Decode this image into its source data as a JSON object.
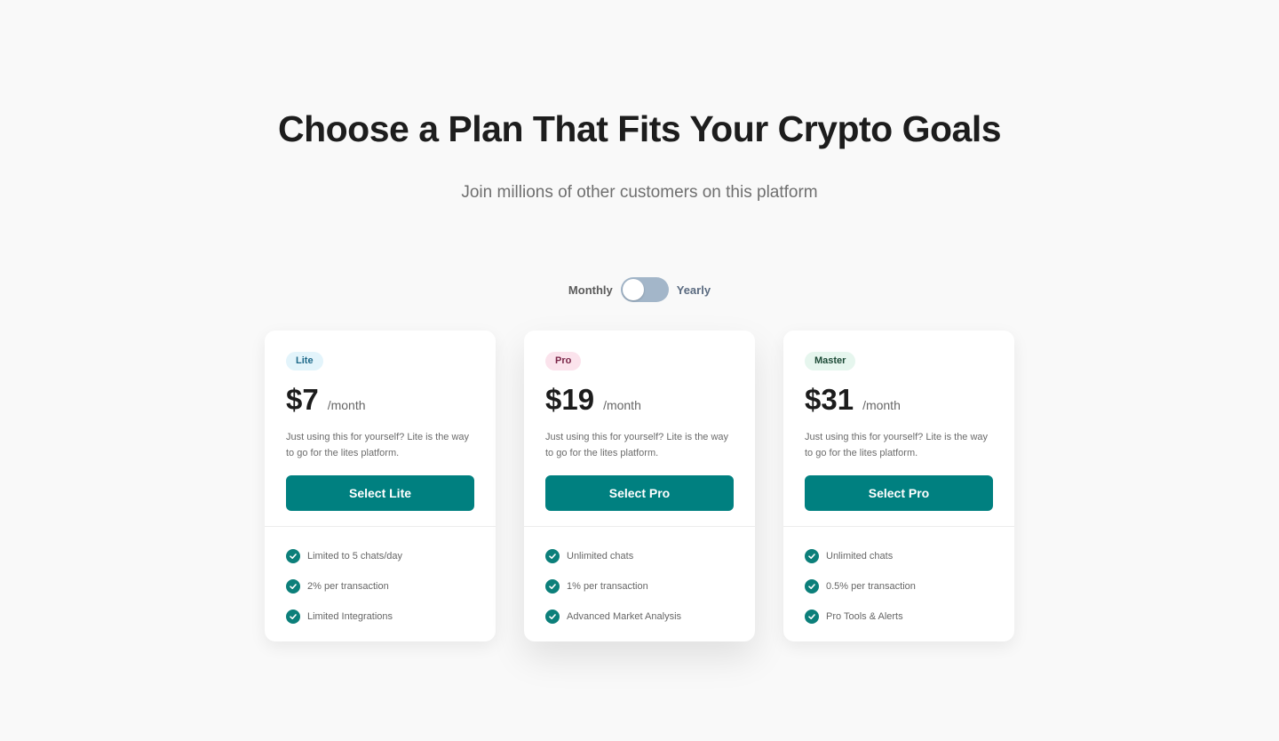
{
  "header": {
    "title": "Choose a Plan That Fits Your Crypto Goals",
    "subtitle": "Join millions of other customers on this platform"
  },
  "billing_toggle": {
    "monthly_label": "Monthly",
    "yearly_label": "Yearly",
    "selected": "Monthly"
  },
  "colors": {
    "accent": "#008080",
    "toggle_track": "#a3b6c9",
    "page_bg": "#f9f9f9"
  },
  "plans": [
    {
      "badge": "Lite",
      "badge_bg": "#e3f4fb",
      "badge_color": "#1f6a8a",
      "price": "$7",
      "period": "/month",
      "description": "Just using this for yourself? Lite is the way to go for the lites platform.",
      "button": "Select Lite",
      "features": [
        "Limited to 5 chats/day",
        "2% per transaction",
        "Limited Integrations"
      ]
    },
    {
      "badge": "Pro",
      "badge_bg": "#fbe3ec",
      "badge_color": "#7a2547",
      "price": "$19",
      "period": "/month",
      "description": "Just using this for yourself? Lite is the way to go for the lites platform.",
      "button": "Select Pro",
      "features": [
        "Unlimited chats",
        "1% per transaction",
        "Advanced Market Analysis"
      ]
    },
    {
      "badge": "Master",
      "badge_bg": "#e6f6ee",
      "badge_color": "#1c4a36",
      "price": "$31",
      "period": "/month",
      "description": "Just using this for yourself? Lite is the way to go for the lites platform.",
      "button": "Select Pro",
      "features": [
        "Unlimited chats",
        "0.5% per transaction",
        "Pro Tools & Alerts"
      ]
    }
  ]
}
